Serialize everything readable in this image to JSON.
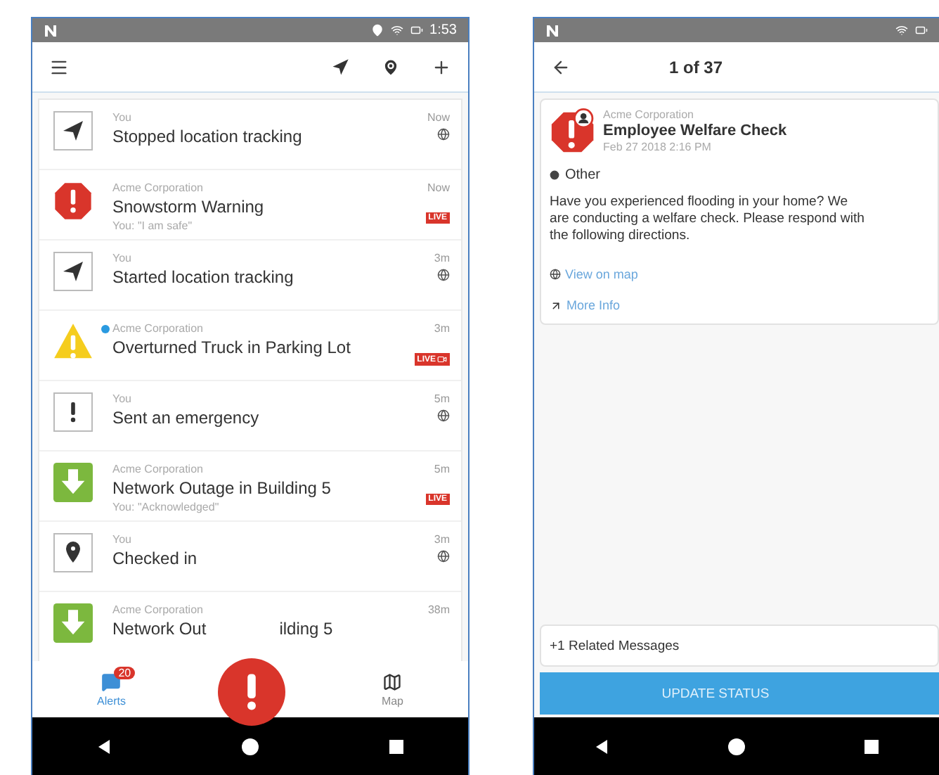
{
  "left_phone": {
    "status_bar": {
      "time": "1:53"
    },
    "alerts": [
      {
        "kind": "navigation",
        "source": "You",
        "title": "Stopped location tracking",
        "time": "Now",
        "indicator": {
          "kind": "globe"
        },
        "unread": false
      },
      {
        "kind": "octagon",
        "source": "Acme Corporation",
        "title": "Snowstorm Warning",
        "reply": "You: \"I am safe\"",
        "time": "Now",
        "indicator": {
          "kind": "live",
          "label": "LIVE"
        },
        "unread": false
      },
      {
        "kind": "navigation",
        "source": "You",
        "title": "Started location tracking",
        "time": "3m",
        "indicator": {
          "kind": "globe"
        },
        "unread": false
      },
      {
        "kind": "triangle",
        "source": "Acme Corporation",
        "title": "Overturned Truck in Parking Lot",
        "time": "3m",
        "indicator": {
          "kind": "live-video",
          "label": "LIVE"
        },
        "unread": true
      },
      {
        "kind": "exclamation",
        "source": "You",
        "title": "Sent an emergency",
        "time": "5m",
        "indicator": {
          "kind": "globe"
        },
        "unread": false
      },
      {
        "kind": "arrow-down",
        "source": "Acme Corporation",
        "title": "Network Outage in Building 5",
        "reply": "You: \"Acknowledged\"",
        "time": "5m",
        "indicator": {
          "kind": "live",
          "label": "LIVE"
        },
        "unread": false
      },
      {
        "kind": "pin",
        "source": "You",
        "title": "Checked in",
        "time": "3m",
        "indicator": {
          "kind": "globe"
        },
        "unread": false
      },
      {
        "kind": "arrow-down",
        "source": "Acme Corporation",
        "title_parts": [
          "Network Out",
          "ilding 5"
        ],
        "time": "38m",
        "unread": false
      }
    ],
    "bottom_nav": [
      {
        "kind": "alerts",
        "label": "Alerts",
        "badge": "20",
        "selected": true
      },
      {
        "kind": "map",
        "label": "Map",
        "selected": false
      }
    ]
  },
  "right_phone": {
    "header": {
      "title": "1 of 37"
    },
    "message": {
      "source": "Acme Corporation",
      "title": "Employee Welfare Check",
      "date": "Feb 27 2018 2:16 PM",
      "category": "Other",
      "body": "Have you experienced flooding in your home? We are conducting a welfare check. Please respond with the following directions.",
      "links": [
        {
          "kind": "map",
          "label": "View on map"
        },
        {
          "kind": "external",
          "label": "More Info"
        }
      ]
    },
    "related": "+1 Related Messages",
    "action_button": "UPDATE STATUS"
  }
}
